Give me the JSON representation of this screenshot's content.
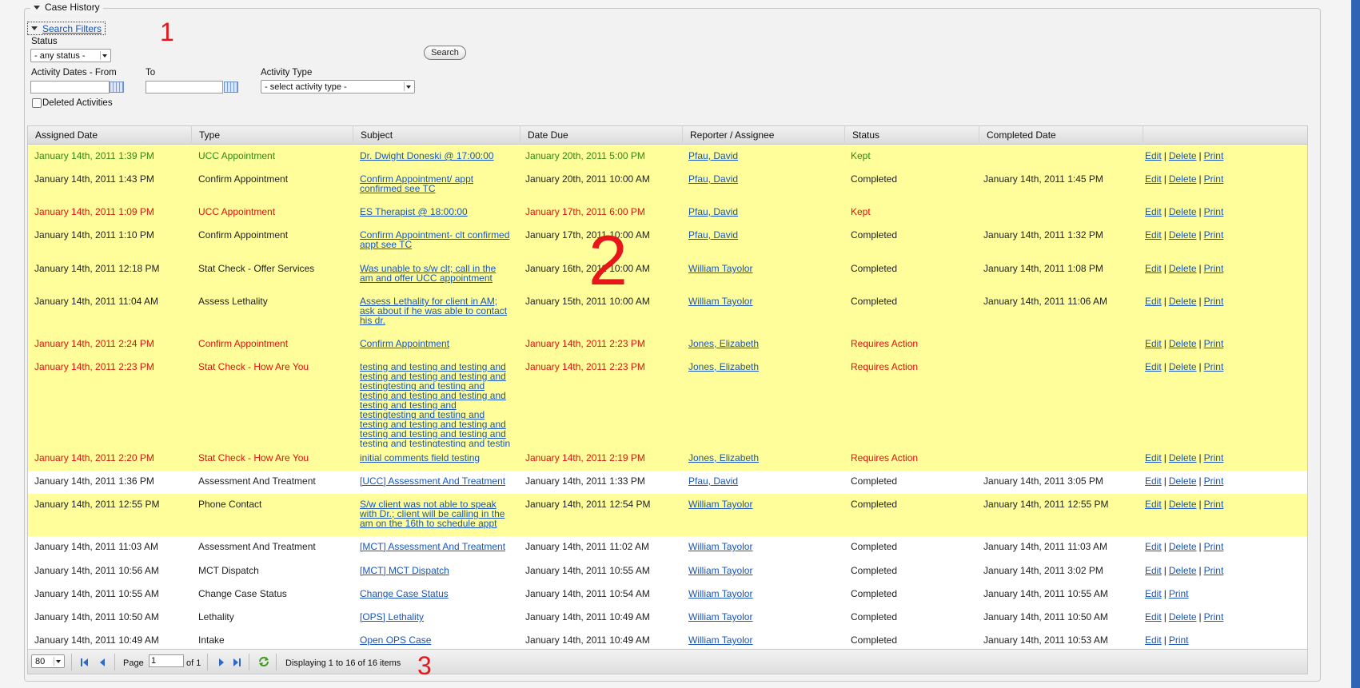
{
  "case_history": {
    "title": "Case History"
  },
  "filters": {
    "toggle_label": "Search Filters",
    "status_label": "Status",
    "status_value": "- any status -",
    "search_button": "Search",
    "from_label": "Activity Dates - From",
    "to_label": "To",
    "activity_type_label": "Activity Type",
    "activity_type_value": "- select activity type -",
    "deleted_label": "Deleted Activities"
  },
  "annotations": {
    "a1": "1",
    "a2": "2",
    "a3": "3"
  },
  "grid": {
    "columns": [
      "Assigned Date",
      "Type",
      "Subject",
      "Date Due",
      "Reporter / Assignee",
      "Status",
      "Completed Date"
    ],
    "rows": [
      {
        "assigned": "January 14th, 2011 1:39 PM",
        "type": "UCC Appointment",
        "subject": "Dr. Dwight Doneski @ 17:00:00",
        "due": "January 20th, 2011 5:00 PM",
        "reporter": "Pfau, David",
        "status": "Kept",
        "completed": "",
        "actions": [
          "Edit",
          "Delete",
          "Print"
        ]
      },
      {
        "assigned": "January 14th, 2011 1:43 PM",
        "type": "Confirm Appointment",
        "subject": "Confirm Appointment/ appt confirmed see TC",
        "due": "January 20th, 2011 10:00 AM",
        "reporter": "Pfau, David",
        "status": "Completed",
        "completed": "January 14th, 2011 1:45 PM",
        "actions": [
          "Edit",
          "Delete",
          "Print"
        ]
      },
      {
        "assigned": "January 14th, 2011 1:09 PM",
        "type": "UCC Appointment",
        "subject": "ES Therapist @ 18:00:00",
        "due": "January 17th, 2011 6:00 PM",
        "reporter": "Pfau, David",
        "status": "Kept",
        "completed": "",
        "actions": [
          "Edit",
          "Delete",
          "Print"
        ]
      },
      {
        "assigned": "January 14th, 2011 1:10 PM",
        "type": "Confirm Appointment",
        "subject": "Confirm Appointment- clt confirmed appt see TC",
        "due": "January 17th, 2011 10:00 AM",
        "reporter": "Pfau, David",
        "status": "Completed",
        "completed": "January 14th, 2011 1:32 PM",
        "actions": [
          "Edit",
          "Delete",
          "Print"
        ]
      },
      {
        "assigned": "January 14th, 2011 12:18 PM",
        "type": "Stat Check - Offer Services",
        "subject": "Was unable to s/w clt; call in the am and offer UCC appointment",
        "due": "January 16th, 2011 10:00 AM",
        "reporter": "William Tayolor",
        "status": "Completed",
        "completed": "January 14th, 2011 1:08 PM",
        "actions": [
          "Edit",
          "Delete",
          "Print"
        ]
      },
      {
        "assigned": "January 14th, 2011 11:04 AM",
        "type": "Assess Lethality",
        "subject": "Assess Lethality for client in AM; ask about if he was able to contact his dr.",
        "due": "January 15th, 2011 10:00 AM",
        "reporter": "William Tayolor",
        "status": "Completed",
        "completed": "January 14th, 2011 11:06 AM",
        "actions": [
          "Edit",
          "Delete",
          "Print"
        ]
      },
      {
        "assigned": "January 14th, 2011 2:24 PM",
        "type": "Confirm Appointment",
        "subject": "Confirm Appointment",
        "due": "January 14th, 2011 2:23 PM",
        "reporter": "Jones, Elizabeth",
        "status": "Requires Action",
        "completed": "",
        "actions": [
          "Edit",
          "Delete",
          "Print"
        ]
      },
      {
        "assigned": "January 14th, 2011 2:23 PM",
        "type": "Stat Check - How Are You",
        "subject": "testing and testing and testing and testing and testing and testing and testingtesting and testing and testing and testing and testing and testing and testing and testingtesting and testing and testing and testing and testing and testing and testing and testing and testing and testingtesting and testin",
        "due": "January 14th, 2011 2:23 PM",
        "reporter": "Jones, Elizabeth",
        "status": "Requires Action",
        "completed": "",
        "actions": [
          "Edit",
          "Delete",
          "Print"
        ]
      },
      {
        "assigned": "January 14th, 2011 2:20 PM",
        "type": "Stat Check - How Are You",
        "subject": "initial comments field testing",
        "due": "January 14th, 2011 2:19 PM",
        "reporter": "Jones, Elizabeth",
        "status": "Requires Action",
        "completed": "",
        "actions": [
          "Edit",
          "Delete",
          "Print"
        ]
      },
      {
        "assigned": "January 14th, 2011 1:36 PM",
        "type": "Assessment And Treatment",
        "subject": "[UCC] Assessment And Treatment",
        "due": "January 14th, 2011 1:33 PM",
        "reporter": "Pfau, David",
        "status": "Completed",
        "completed": "January 14th, 2011 3:05 PM",
        "actions": [
          "Edit",
          "Delete",
          "Print"
        ]
      },
      {
        "assigned": "January 14th, 2011 12:55 PM",
        "type": "Phone Contact",
        "subject": "S/w client was not able to speak with Dr.; client will be calling in the am on the 16th to schedule appt",
        "due": "January 14th, 2011 12:54 PM",
        "reporter": "William Tayolor",
        "status": "Completed",
        "completed": "January 14th, 2011 12:55 PM",
        "actions": [
          "Edit",
          "Delete",
          "Print"
        ]
      },
      {
        "assigned": "January 14th, 2011 11:03 AM",
        "type": "Assessment And Treatment",
        "subject": "[MCT] Assessment And Treatment",
        "due": "January 14th, 2011 11:02 AM",
        "reporter": "William Tayolor",
        "status": "Completed",
        "completed": "January 14th, 2011 11:03 AM",
        "actions": [
          "Edit",
          "Delete",
          "Print"
        ]
      },
      {
        "assigned": "January 14th, 2011 10:56 AM",
        "type": "MCT Dispatch",
        "subject": "[MCT] MCT Dispatch",
        "due": "January 14th, 2011 10:55 AM",
        "reporter": "William Tayolor",
        "status": "Completed",
        "completed": "January 14th, 2011 3:02 PM",
        "actions": [
          "Edit",
          "Delete",
          "Print"
        ]
      },
      {
        "assigned": "January 14th, 2011 10:55 AM",
        "type": "Change Case Status",
        "subject": "Change Case Status",
        "due": "January 14th, 2011 10:54 AM",
        "reporter": "William Tayolor",
        "status": "Completed",
        "completed": "January 14th, 2011 10:55 AM",
        "actions": [
          "Edit",
          "Print"
        ]
      },
      {
        "assigned": "January 14th, 2011 10:50 AM",
        "type": "Lethality",
        "subject": "[OPS] Lethality",
        "due": "January 14th, 2011 10:49 AM",
        "reporter": "William Tayolor",
        "status": "Completed",
        "completed": "January 14th, 2011 10:50 AM",
        "actions": [
          "Edit",
          "Delete",
          "Print"
        ]
      },
      {
        "assigned": "January 14th, 2011 10:49 AM",
        "type": "Intake",
        "subject": "Open OPS Case",
        "due": "January 14th, 2011 10:49 AM",
        "reporter": "William Tayolor",
        "status": "Completed",
        "completed": "January 14th, 2011 10:53 AM",
        "actions": [
          "Edit",
          "Print"
        ]
      }
    ]
  },
  "pager": {
    "page_size": "80",
    "page_label": "Page",
    "page_value": "1",
    "of_label": "of 1",
    "display_text": "Displaying 1 to 16 of 16 items"
  },
  "colors": {
    "highlight_yellow": "#fffe9b",
    "overdue_red": "#e01010",
    "kept_green": "#2e8a12",
    "link_blue": "#1a55b8"
  }
}
